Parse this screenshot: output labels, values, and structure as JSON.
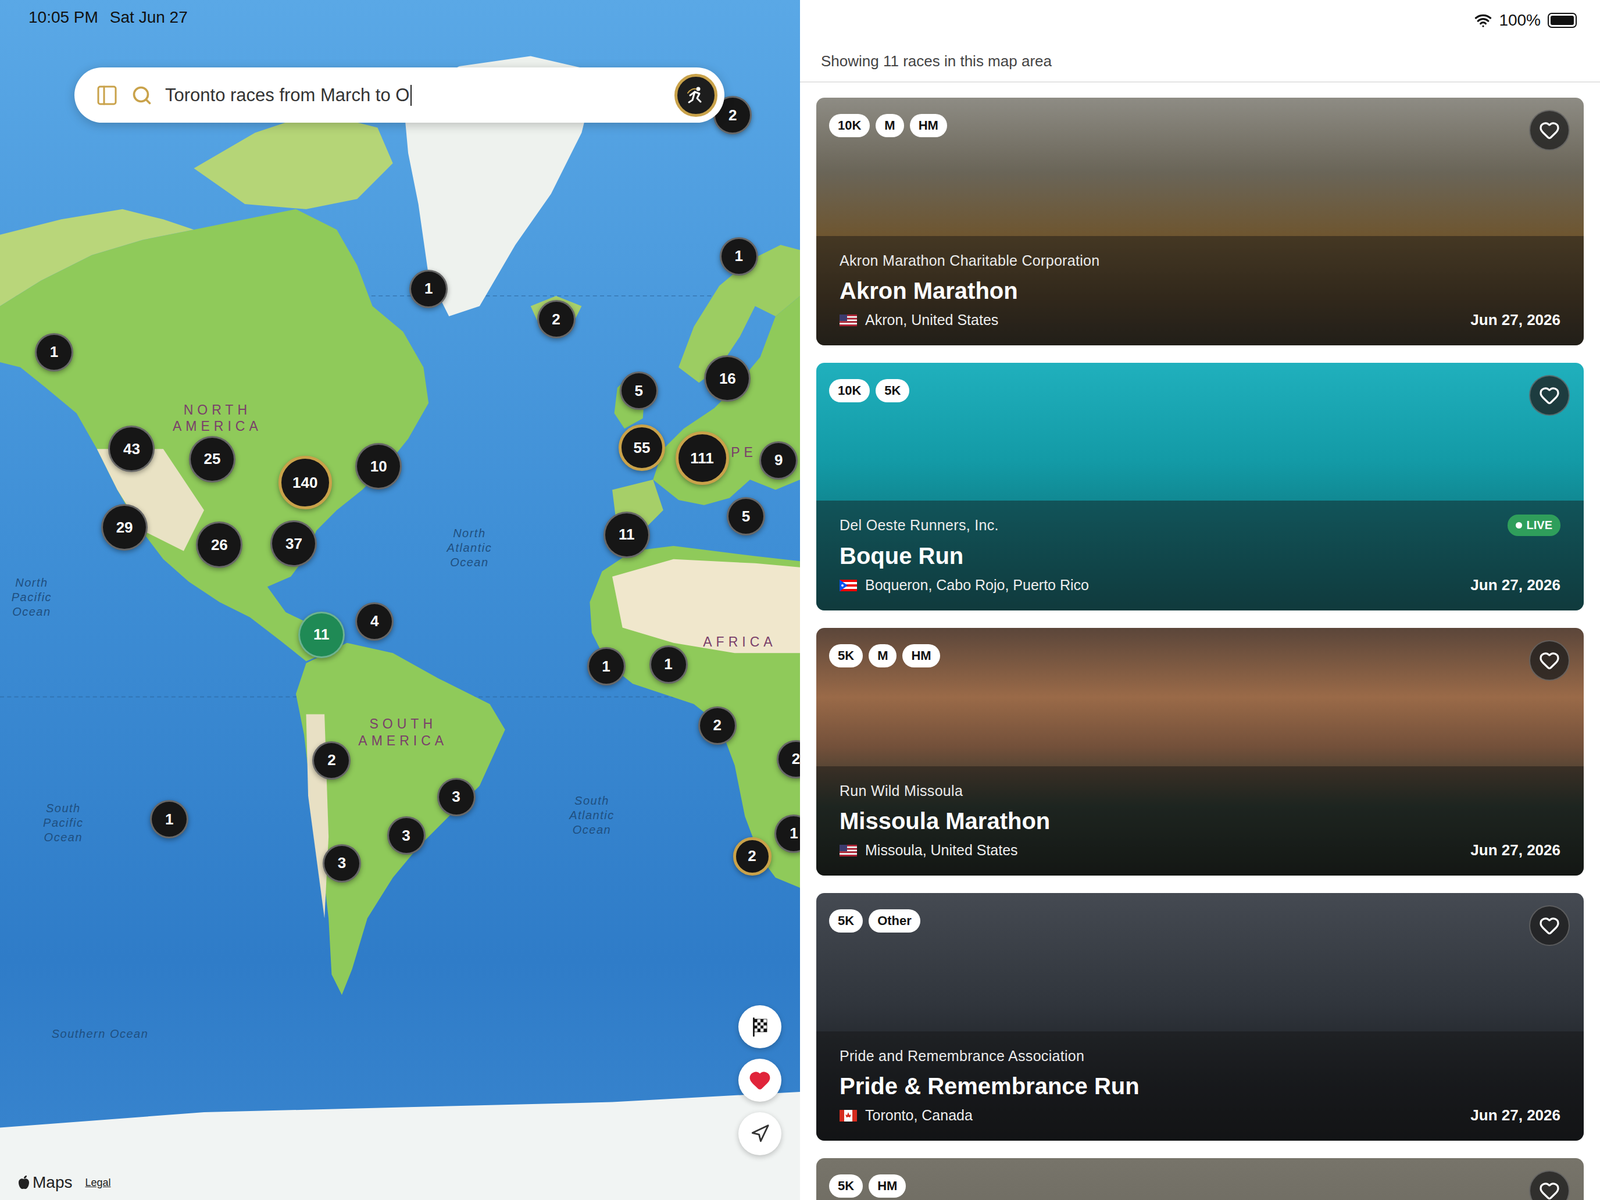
{
  "status_bar": {
    "time": "10:05 PM",
    "date": "Sat Jun 27",
    "battery": "100%",
    "battery_level": 1
  },
  "search": {
    "value": "Toronto races from March to O",
    "focused": true
  },
  "map": {
    "pins": [
      {
        "count": "2",
        "highlighted": false,
        "selected": false
      },
      {
        "count": "1",
        "highlighted": false,
        "selected": false
      },
      {
        "count": "1",
        "highlighted": false,
        "selected": false
      },
      {
        "count": "2",
        "highlighted": false,
        "selected": false
      },
      {
        "count": "1",
        "highlighted": false,
        "selected": false
      },
      {
        "count": "5",
        "highlighted": false,
        "selected": false
      },
      {
        "count": "16",
        "highlighted": false,
        "selected": false
      },
      {
        "count": "43",
        "highlighted": false,
        "selected": false
      },
      {
        "count": "25",
        "highlighted": false,
        "selected": false
      },
      {
        "count": "140",
        "highlighted": true,
        "selected": false
      },
      {
        "count": "10",
        "highlighted": false,
        "selected": false
      },
      {
        "count": "55",
        "highlighted": true,
        "selected": false
      },
      {
        "count": "111",
        "highlighted": true,
        "selected": false
      },
      {
        "count": "9",
        "highlighted": false,
        "selected": false
      },
      {
        "count": "29",
        "highlighted": false,
        "selected": false
      },
      {
        "count": "26",
        "highlighted": false,
        "selected": false
      },
      {
        "count": "37",
        "highlighted": false,
        "selected": false
      },
      {
        "count": "11",
        "highlighted": false,
        "selected": false
      },
      {
        "count": "5",
        "highlighted": false,
        "selected": false
      },
      {
        "count": "11",
        "highlighted": false,
        "selected": true
      },
      {
        "count": "4",
        "highlighted": false,
        "selected": false
      },
      {
        "count": "1",
        "highlighted": false,
        "selected": false
      },
      {
        "count": "1",
        "highlighted": false,
        "selected": false
      },
      {
        "count": "2",
        "highlighted": false,
        "selected": false
      },
      {
        "count": "2",
        "highlighted": false,
        "selected": false
      },
      {
        "count": "1",
        "highlighted": false,
        "selected": false
      },
      {
        "count": "2",
        "highlighted": false,
        "selected": false
      },
      {
        "count": "3",
        "highlighted": false,
        "selected": false
      },
      {
        "count": "3",
        "highlighted": false,
        "selected": false
      },
      {
        "count": "3",
        "highlighted": false,
        "selected": false
      },
      {
        "count": "1",
        "highlighted": false,
        "selected": false
      },
      {
        "count": "2",
        "highlighted": true,
        "selected": false
      }
    ],
    "labels": [
      {
        "lines": [
          "NORTH",
          "AMERICA"
        ],
        "kind": "continent"
      },
      {
        "lines": [
          "SOUTH",
          "AMERICA"
        ],
        "kind": "continent"
      },
      {
        "lines": [
          "AFRICA"
        ],
        "kind": "continent"
      },
      {
        "lines": [
          "PE"
        ],
        "kind": "continent"
      },
      {
        "lines": [
          "North",
          "Atlantic",
          "Ocean"
        ],
        "kind": "ocean"
      },
      {
        "lines": [
          "North",
          "Pacific",
          "Ocean"
        ],
        "kind": "ocean"
      },
      {
        "lines": [
          "South",
          "Pacific",
          "Ocean"
        ],
        "kind": "ocean"
      },
      {
        "lines": [
          "South",
          "Atlantic",
          "Ocean"
        ],
        "kind": "ocean"
      },
      {
        "lines": [
          "Southern Ocean"
        ],
        "kind": "ocean"
      }
    ],
    "controls": [
      {
        "kind": "finish",
        "active": false
      },
      {
        "kind": "favorites",
        "active": true
      },
      {
        "kind": "locate",
        "active": false
      }
    ],
    "attribution": {
      "brand": "Maps",
      "legal": "Legal"
    }
  },
  "list": {
    "summary": "Showing 11 races in this map area",
    "races": [
      {
        "tags": [
          "10K",
          "M",
          "HM"
        ],
        "organizer": "Akron Marathon Charitable Corporation",
        "title": "Akron Marathon",
        "location": "Akron, United States",
        "flag": "us",
        "date": "Jun 27, 2026",
        "live": false,
        "favorite": false
      },
      {
        "tags": [
          "10K",
          "5K"
        ],
        "organizer": "Del Oeste Runners, Inc.",
        "title": "Boque Run",
        "location": "Boqueron, Cabo Rojo, Puerto Rico",
        "flag": "pr",
        "date": "Jun 27, 2026",
        "live": true,
        "live_label": "LIVE",
        "favorite": false
      },
      {
        "tags": [
          "5K",
          "M",
          "HM"
        ],
        "organizer": "Run Wild Missoula",
        "title": "Missoula Marathon",
        "location": "Missoula, United States",
        "flag": "us",
        "date": "Jun 27, 2026",
        "live": false,
        "favorite": false
      },
      {
        "tags": [
          "5K",
          "Other"
        ],
        "organizer": "Pride and Remembrance Association",
        "title": "Pride & Remembrance Run",
        "location": "Toronto, Canada",
        "flag": "ca",
        "date": "Jun 27, 2026",
        "live": false,
        "favorite": false
      },
      {
        "tags": [
          "5K",
          "HM"
        ],
        "favorite": false
      }
    ]
  }
}
